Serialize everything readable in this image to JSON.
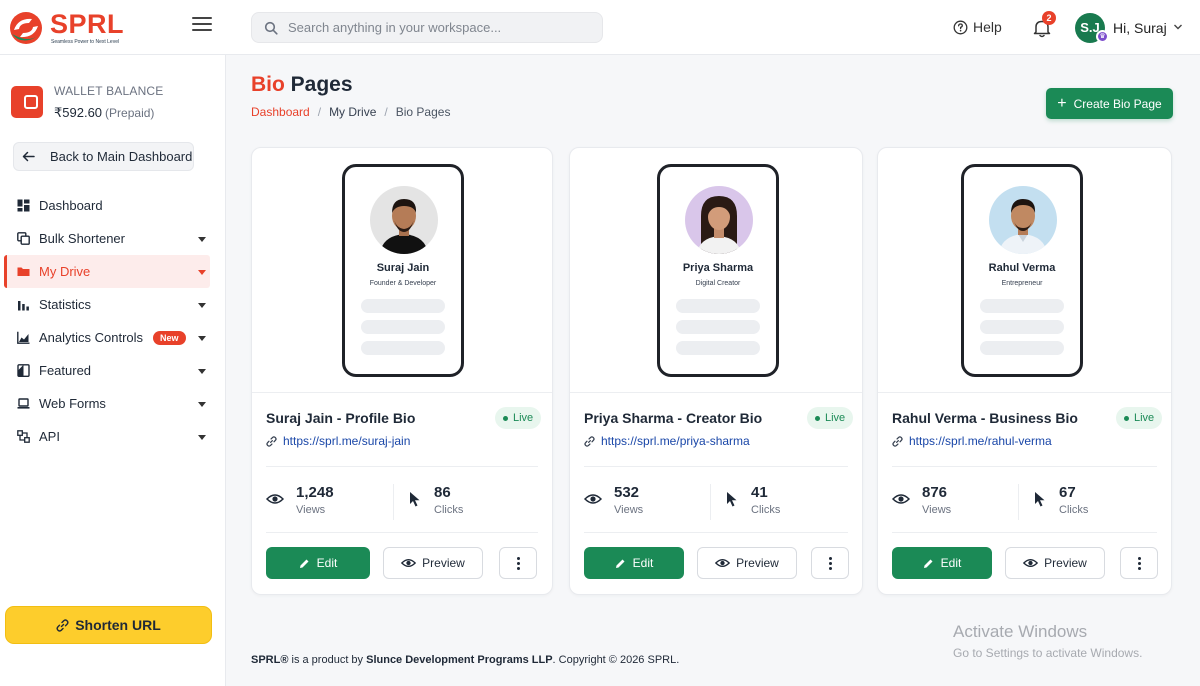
{
  "header": {
    "brand_name": "SPRL",
    "brand_tagline": "Seamless Power to Next Level",
    "search_placeholder": "Search anything in your workspace...",
    "help_label": "Help",
    "notification_count": "2",
    "avatar_initials": "S.J",
    "avatar_badge": "♛",
    "greeting": "Hi, Suraj"
  },
  "sidebar": {
    "wallet_label": "WALLET BALANCE",
    "wallet_amount": "₹592.60",
    "wallet_type": "(Prepaid)",
    "back_label": "Back to Main Dashboard",
    "items": [
      {
        "label": "Dashboard",
        "icon": "dashboard-icon"
      },
      {
        "label": "Bulk Shortener",
        "icon": "copy-icon"
      },
      {
        "label": "My Drive",
        "icon": "folder-icon"
      },
      {
        "label": "Statistics",
        "icon": "bar-chart-icon"
      },
      {
        "label": "Analytics Controls",
        "icon": "area-chart-icon",
        "badge": "New"
      },
      {
        "label": "Featured",
        "icon": "featured-icon"
      },
      {
        "label": "Web Forms",
        "icon": "laptop-icon"
      },
      {
        "label": "API",
        "icon": "api-icon"
      }
    ],
    "shorten_label": "Shorten URL"
  },
  "page": {
    "title_accent": "Bio",
    "title_rest": "Pages",
    "breadcrumb": [
      "Dashboard",
      "My Drive",
      "Bio Pages"
    ],
    "create_label": "Create Bio Page"
  },
  "cards": [
    {
      "person_name": "Suraj Jain",
      "person_role": "Founder & Developer",
      "title": "Suraj Jain - Profile Bio",
      "status": "Live",
      "url": "https://sprl.me/suraj-jain",
      "views": "1,248",
      "views_label": "Views",
      "clicks": "86",
      "clicks_label": "Clicks",
      "edit_label": "Edit",
      "preview_label": "Preview"
    },
    {
      "person_name": "Priya Sharma",
      "person_role": "Digital Creator",
      "title": "Priya Sharma - Creator Bio",
      "status": "Live",
      "url": "https://sprl.me/priya-sharma",
      "views": "532",
      "views_label": "Views",
      "clicks": "41",
      "clicks_label": "Clicks",
      "edit_label": "Edit",
      "preview_label": "Preview"
    },
    {
      "person_name": "Rahul Verma",
      "person_role": "Entrepreneur",
      "title": "Rahul Verma - Business Bio",
      "status": "Live",
      "url": "https://sprl.me/rahul-verma",
      "views": "876",
      "views_label": "Views",
      "clicks": "67",
      "clicks_label": "Clicks",
      "edit_label": "Edit",
      "preview_label": "Preview"
    }
  ],
  "footer": {
    "brand": "SPRL®",
    "text_1": " is a product by ",
    "company": "Slunce Development Programs LLP",
    "text_2": ". Copyright © 2026 SPRL."
  },
  "watermark": {
    "title": "Activate Windows",
    "subtitle": "Go to Settings to activate Windows."
  },
  "colors": {
    "brand_red": "#e8412a",
    "primary_green": "#1b8a56",
    "accent_yellow": "#fdcd2c"
  }
}
